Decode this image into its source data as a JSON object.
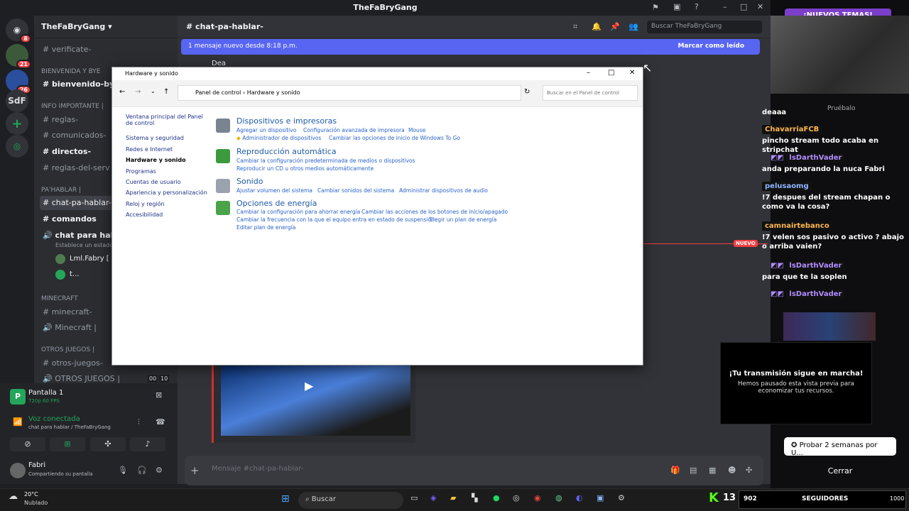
{
  "window": {
    "title": "TheFaBryGang"
  },
  "rail": {
    "badges": [
      "8",
      "21",
      "26"
    ],
    "sdf": "SdF"
  },
  "server": {
    "name": "TheFaBryGang"
  },
  "channels": [
    {
      "label": "verificate-",
      "type": "text"
    },
    {
      "label": "bienvenido-bye-",
      "type": "text",
      "bold": true
    },
    {
      "label": "reglas-",
      "type": "text"
    },
    {
      "label": "comunicados-",
      "type": "text"
    },
    {
      "label": "directos-",
      "type": "text",
      "bold": true
    },
    {
      "label": "reglas-del-serv",
      "type": "text"
    },
    {
      "label": "chat-pa-hablar-",
      "type": "text",
      "selected": true
    },
    {
      "label": "comandos",
      "type": "text",
      "bold": true
    },
    {
      "label": "chat para hablar",
      "type": "voice",
      "bold": true
    },
    {
      "label": "minecraft-",
      "type": "text"
    },
    {
      "label": "Minecraft |",
      "type": "voice"
    },
    {
      "label": "otros-juegos-",
      "type": "text"
    },
    {
      "label": "OTROS JUEGOS |",
      "type": "voice"
    }
  ],
  "categories": [
    "Bienvenida Y Bye",
    "INFO IMPORTANTE |",
    "PA'HABLAR |",
    "MINECRAFT",
    "OTROS JUEGOS |"
  ],
  "voice": {
    "sub": "Establece un estado pa",
    "users": [
      "Lml.Fabry [",
      "t..."
    ],
    "counts": [
      "00",
      "10"
    ]
  },
  "screen": {
    "title": "Pantalla 1",
    "quality": "720p 60 FPS"
  },
  "voice_status": {
    "title": "Voz conectada",
    "sub": "chat para hablar / TheFaBryGang"
  },
  "user": {
    "name": "Fabri",
    "status": "Compartiendo su pantalla"
  },
  "chat": {
    "channel": "chat-pa-hablar-",
    "search_placeholder": "Buscar TheFaBryGang",
    "new_messages": "1 mensaje nuevo desde 8:18 p.m.",
    "mark_read": "Marcar como leído",
    "author": "Dea",
    "new_label": "NUEVO",
    "composer_placeholder": "Mensaje #chat-pa-hablar-"
  },
  "control_panel": {
    "title": "Hardware y sonido",
    "crumbs": [
      "Panel de control",
      "Hardware y sonido"
    ],
    "search_placeholder": "Buscar en el Panel de control",
    "nav": [
      "Ventana principal del Panel de control",
      "Sistema y seguridad",
      "Redes e Internet",
      "Hardware y sonido",
      "Programas",
      "Cuentas de usuario",
      "Apariencia y personalización",
      "Reloj y región",
      "Accesibilidad"
    ],
    "groups": [
      {
        "title": "Dispositivos e impresoras",
        "links": [
          [
            "Agregar un dispositivo",
            "Configuración avanzada de impresora",
            "Mouse"
          ],
          [
            "Administrador de dispositivos",
            "Cambiar las opciones de inicio de Windows To Go"
          ]
        ]
      },
      {
        "title": "Reproducción automática",
        "links": [
          [
            "Cambiar la configuración predeterminada de medios o dispositivos"
          ],
          [
            "Reproducir un CD u otros medios automáticamente"
          ]
        ]
      },
      {
        "title": "Sonido",
        "links": [
          [
            "Ajustar volumen del sistema",
            "Cambiar sonidos del sistema",
            "Administrar dispositivos de audio"
          ]
        ]
      },
      {
        "title": "Opciones de energía",
        "links": [
          [
            "Cambiar la configuración para ahorrar energía",
            "Cambiar las acciones de los botones de inicio/apagado"
          ],
          [
            "Cambiar la frecuencia con la que el equipo entra en estado de suspensión",
            "Elegir un plan de energía"
          ],
          [
            "Editar plan de energía"
          ]
        ]
      }
    ]
  },
  "stream": {
    "banner": "¡NUEVOS TEMAS!",
    "pruebalo": "Pruébalo",
    "chat": [
      {
        "text": "deaaa"
      },
      {
        "user": "ChavarriaFCB"
      },
      {
        "text": "pincho stream todo acaba en stripchat"
      },
      {
        "user": "lsDarthVader"
      },
      {
        "text": "anda preparando la nuca Fabri"
      },
      {
        "user": "pelusaomg"
      },
      {
        "text": "!7 despues del stream chapan o como va la cosa?"
      },
      {
        "user": "camnairtebanco"
      },
      {
        "text": "!7 velen sos pasivo o activo ? abajo o arriba vaien?"
      },
      {
        "user": "lsDarthVader"
      },
      {
        "text": "para que te la soplen"
      },
      {
        "user": "lsDarthVader"
      }
    ],
    "alert_title": "¡Tu transmisión sigue en marcha!",
    "alert_body": "Hemos pausado esta vista previa para economizar tus recursos.",
    "try_button": "Probar 2 semanas por U...",
    "close_button": "Cerrar"
  },
  "taskbar": {
    "weather_temp": "20°C",
    "weather_desc": "Nublado",
    "search": "Buscar",
    "kick_count": "13",
    "followers_count": "902",
    "followers_label": "SEGUIDORES",
    "goal": "1000"
  }
}
